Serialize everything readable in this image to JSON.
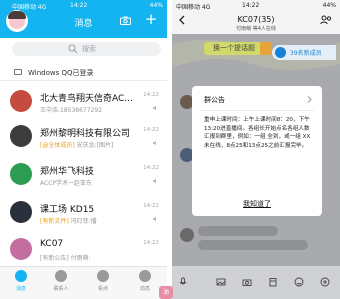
{
  "left": {
    "status": {
      "carrier": "中国移动 4G",
      "time": "14:22",
      "battery": "44%"
    },
    "header": {
      "title": "消息"
    },
    "search": {
      "placeholder": "搜索"
    },
    "windows_login": "Windows QQ已登录",
    "chats": [
      {
        "name": "北大青鸟翔天信奇AC...",
        "time": "14:22",
        "sub": "王中浩:18538677292",
        "tag": "",
        "avatar_color": "#c54b3f"
      },
      {
        "name": "郑州黎明科技有限公司",
        "time": "14:22",
        "sub": " 安庆龙:[图片]",
        "tag": "[@全体成员]",
        "avatar_color": "#3c3c3c"
      },
      {
        "name": "郑州华飞科技",
        "time": "14:22",
        "sub": "ACCP学术一赵亚东",
        "tag": "",
        "avatar_color": "#2b9c52"
      },
      {
        "name": "课工场 KD15",
        "time": "14:22",
        "sub": " 冯玎菲:播",
        "tag": "[有新文件]",
        "avatar_color": "#2a2f3c"
      },
      {
        "name": "KC07",
        "time": "14:22",
        "sub": "[有新公告] 付雨萌:",
        "tag": "",
        "avatar_color": "#c26fa0"
      }
    ],
    "tabs": [
      {
        "label": "消息"
      },
      {
        "label": "联系人"
      },
      {
        "label": "看点"
      },
      {
        "label": "动态"
      }
    ]
  },
  "right": {
    "status": {
      "carrier": "中国移动 4G",
      "time": "14:22",
      "battery": "44%"
    },
    "header": {
      "title": "KC07(35)",
      "subtitle": "付雨萌 等4人在线"
    },
    "theme_pill": "换一个提话题",
    "online_pill": "39名新成员",
    "modal": {
      "title": "群公告",
      "body": "重申上课时间：上午上课时间8：20，下午13:20进直播间。各组长开始点名各组人数汇报到群里，例如：一组 全到，或一组 XX未在线，8点25和13点25之前汇报完毕。",
      "button": "我知道了"
    }
  },
  "watermark": "油"
}
